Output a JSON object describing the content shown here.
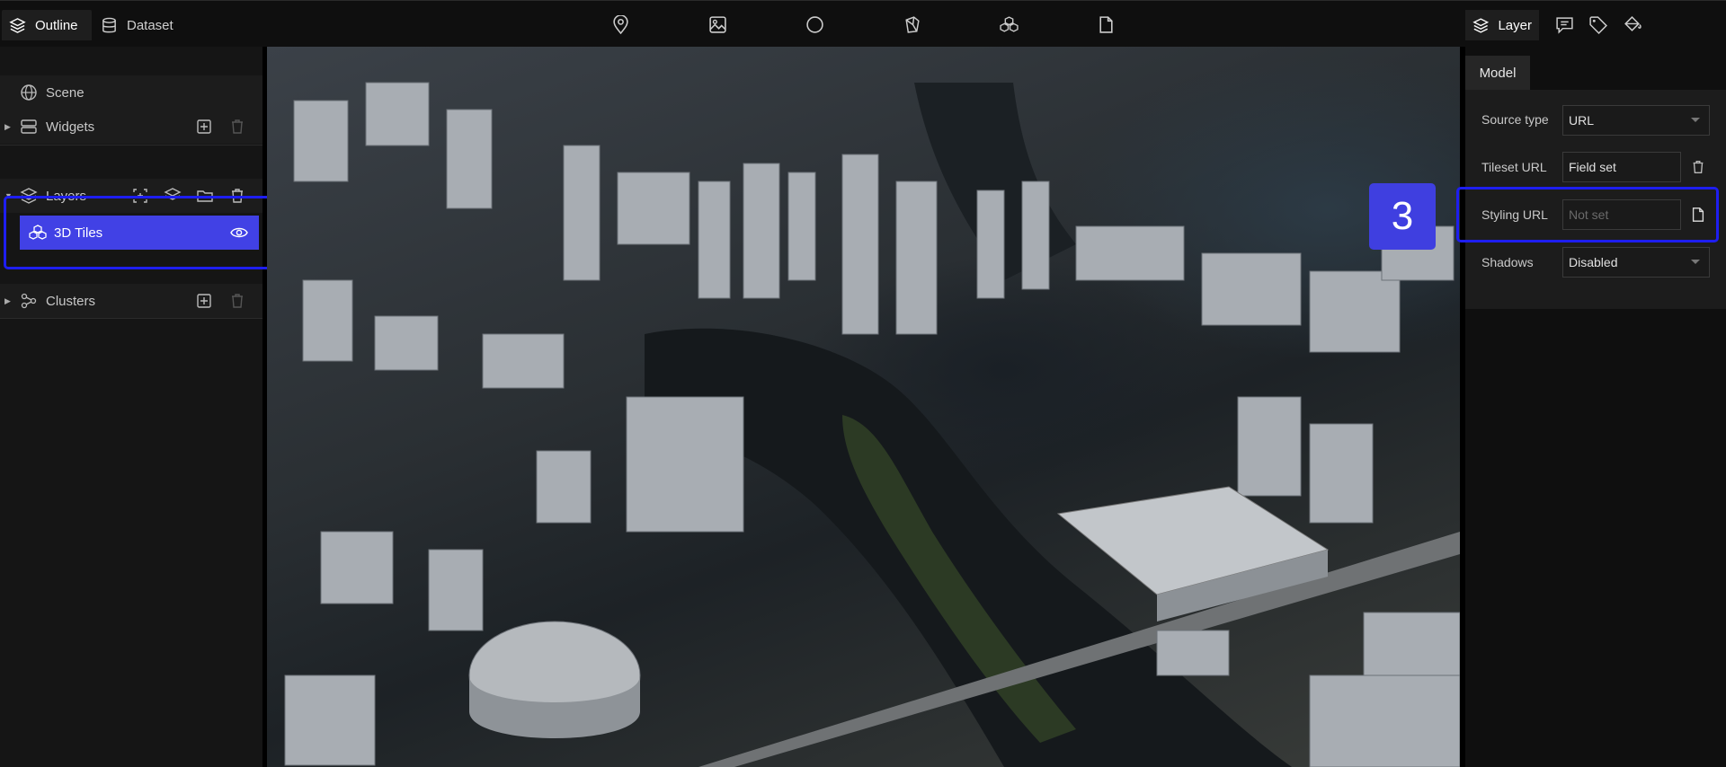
{
  "top_tabs": {
    "outline": "Outline",
    "dataset": "Dataset"
  },
  "toolbar": [
    "marker-icon",
    "image-icon",
    "circle-icon",
    "polygon-box-icon",
    "cluster-icon",
    "file-icon"
  ],
  "outline": {
    "scene": "Scene",
    "widgets": "Widgets",
    "layers": "Layers",
    "selected_layer": "3D Tiles",
    "clusters": "Clusters"
  },
  "right_panel": {
    "tab": "Layer",
    "section": "Model",
    "fields": {
      "source_type_label": "Source type",
      "source_type_value": "URL",
      "tileset_url_label": "Tileset URL",
      "tileset_url_value": "Field set",
      "styling_url_label": "Styling URL",
      "styling_url_placeholder": "Not set",
      "shadows_label": "Shadows",
      "shadows_value": "Disabled"
    }
  },
  "step_badge": "3",
  "colors": {
    "accent": "#4141e5",
    "highlight": "#1e1ef0"
  }
}
